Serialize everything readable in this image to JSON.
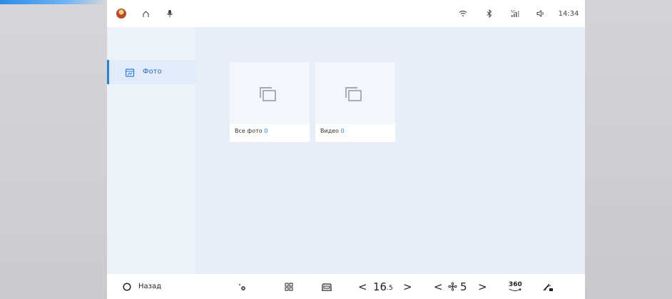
{
  "status_bar": {
    "time": "14:34",
    "icons": [
      "avatar",
      "home-icon",
      "microphone-icon",
      "wifi-icon",
      "bluetooth-icon",
      "signal-icon",
      "volume-icon"
    ]
  },
  "sidebar": {
    "items": [
      {
        "label": "Фото",
        "icon": "photo-album-icon",
        "selected": true
      }
    ]
  },
  "albums": [
    {
      "title": "Все фото",
      "count": "0",
      "icon": "stacked-squares-icon"
    },
    {
      "title": "Видео",
      "count": "0",
      "icon": "stacked-squares-icon"
    }
  ],
  "bottom_bar": {
    "back_label": "Назад",
    "temperature": "16",
    "temperature_decimal": ".5",
    "fan_speed": "5",
    "view_360_label": "360",
    "left_arrow": "<",
    "right_arrow": ">"
  },
  "colors": {
    "accent": "#2b7fd9",
    "screen_bg": "#e8eef7",
    "card_bg": "#ffffff"
  }
}
